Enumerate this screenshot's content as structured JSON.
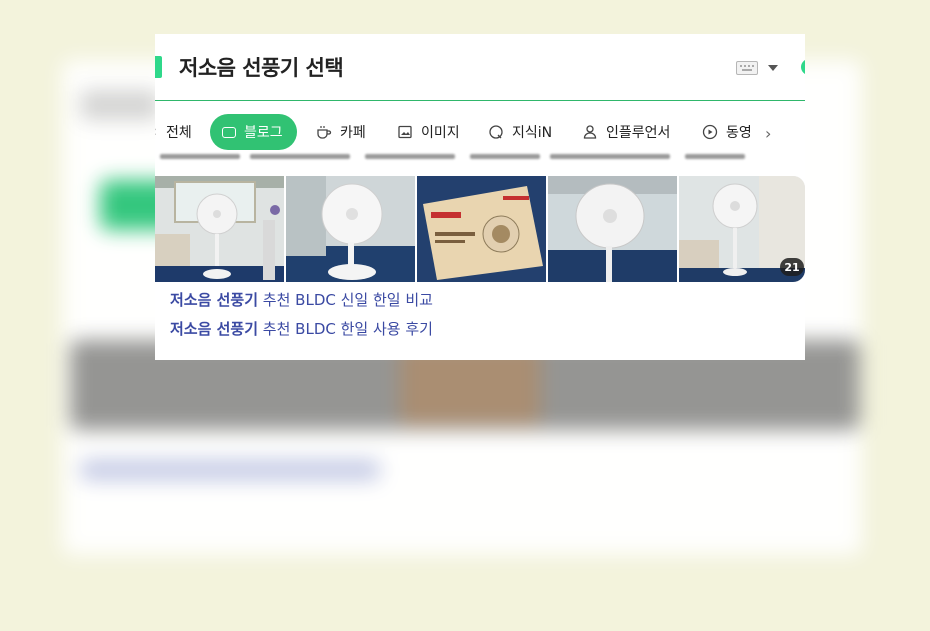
{
  "header": {
    "title": "저소음 선풍기 선택"
  },
  "tabs": [
    {
      "label": "전체",
      "icon": "chevron-left-icon",
      "active": false
    },
    {
      "label": "블로그",
      "icon": "blog-icon",
      "active": true
    },
    {
      "label": "카페",
      "icon": "cafe-icon",
      "active": false
    },
    {
      "label": "이미지",
      "icon": "image-icon",
      "active": false
    },
    {
      "label": "지식iN",
      "icon": "question-icon",
      "active": false
    },
    {
      "label": "인플루언서",
      "icon": "person-icon",
      "active": false
    },
    {
      "label": "동영",
      "icon": "play-icon",
      "active": false
    }
  ],
  "thumbnails": {
    "count_badge": "21"
  },
  "results": [
    {
      "highlight": "저소음 선풍기",
      "rest": " 추천 BLDC 신일 한일 비교"
    },
    {
      "highlight": "저소음 선풍기",
      "rest": " 추천 BLDC 한일 사용 후기"
    }
  ],
  "colors": {
    "accent": "#2fd88a",
    "active_tab": "#31c273",
    "link": "#3b4aa3",
    "page_bg": "#f3f3dc"
  }
}
